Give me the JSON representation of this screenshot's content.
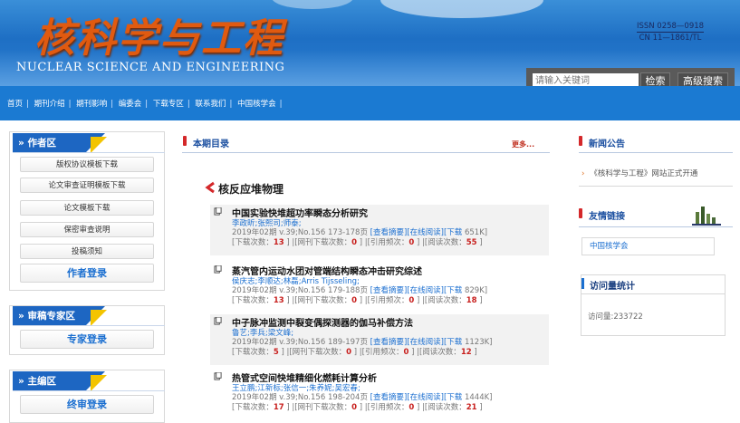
{
  "header": {
    "logo_cn": "核科学与工程",
    "logo_en": "NUCLEAR SCIENCE AND ENGINEERING",
    "issn": "ISSN 0258—0918",
    "cn": "CN 11—1861/TL"
  },
  "search": {
    "placeholder": "请输入关键词",
    "search_label": "检索",
    "advanced_label": "高级搜索"
  },
  "nav": {
    "items": [
      "首页",
      "期刊介绍",
      "期刊影响",
      "编委会",
      "下载专区",
      "联系我们",
      "中国核学会"
    ]
  },
  "left": {
    "author": {
      "title": "作者区",
      "items": [
        "版权协议模板下载",
        "论文审查证明模板下载",
        "论文模板下载",
        "保密审查说明",
        "投稿须知"
      ],
      "login": "作者登录"
    },
    "expert": {
      "title": "审稿专家区",
      "login": "专家登录"
    },
    "editor": {
      "title": "主编区",
      "login": "终审登录"
    }
  },
  "center": {
    "title": "本期目录",
    "more": "更多...",
    "section": "核反应堆物理",
    "articles": [
      {
        "title": "中国实验快堆超功率瞬态分析研究",
        "authors": "李政昕;张熙司;师泰;",
        "meta_pre": "2019年02期 v.39;No.156 173-178页 ",
        "abstract": "[查看摘要]",
        "read": "[在线阅读]",
        "download": "[下载 ",
        "size": "651K]",
        "dl_label": "[下载次数：",
        "dl": "13",
        "cite_label": " ] |[网刊下载次数：",
        "cite": "0",
        "ref_label": " ] |[引用频次：",
        "ref": "0",
        "read_label": " ] |[阅读次数：",
        "reads": "55",
        "end": " ]"
      },
      {
        "title": "蒸汽管内运动水团对管端结构瞬态冲击研究综述",
        "authors": "侯庆志;李顺达;林磊;Arris Tijsseling;",
        "meta_pre": "2019年02期 v.39;No.156 179-188页 ",
        "abstract": "[查看摘要]",
        "read": "[在线阅读]",
        "download": "[下载 ",
        "size": "829K]",
        "dl_label": "[下载次数：",
        "dl": "13",
        "cite_label": " ] |[网刊下载次数：",
        "cite": "0",
        "ref_label": " ] |[引用频次：",
        "ref": "0",
        "read_label": " ] |[阅读次数：",
        "reads": "18",
        "end": " ]"
      },
      {
        "title": "中子脉冲监测中裂变偶探测器的伽马补偿方法",
        "authors": "鲁艺;李兵;梁文峰;",
        "meta_pre": "2019年02期 v.39;No.156 189-197页 ",
        "abstract": "[查看摘要]",
        "read": "[在线阅读]",
        "download": "[下载 ",
        "size": "1123K]",
        "dl_label": "[下载次数：",
        "dl": "5",
        "cite_label": " ] |[网刊下载次数：",
        "cite": "0",
        "ref_label": " ] |[引用频次：",
        "ref": "0",
        "read_label": " ] |[阅读次数：",
        "reads": "12",
        "end": " ]"
      },
      {
        "title": "热管式空间快堆精细化燃耗计算分析",
        "authors": "王立鹏;江新标;张信一;朱养妮;吴宏春;",
        "meta_pre": "2019年02期 v.39;No.156 198-204页 ",
        "abstract": "[查看摘要]",
        "read": "[在线阅读]",
        "download": "[下载 ",
        "size": "1444K]",
        "dl_label": "[下载次数：",
        "dl": "17",
        "cite_label": " ] |[网刊下载次数：",
        "cite": "0",
        "ref_label": " ] |[引用频次：",
        "ref": "0",
        "read_label": " ] |[阅读次数：",
        "reads": "21",
        "end": " ]"
      }
    ]
  },
  "right": {
    "news_title": "新闻公告",
    "news_item": "《核科学与工程》网站正式开通",
    "links_title": "友情链接",
    "links_item": "中国核学会",
    "stats_title": "访问量统计",
    "stats_value": "访问量:233722"
  },
  "colors": {
    "header_blue": "#1e6fc4",
    "nav_blue": "#1b7ad2",
    "accent_red": "#d4282a",
    "link_blue": "#1b6fd0"
  }
}
